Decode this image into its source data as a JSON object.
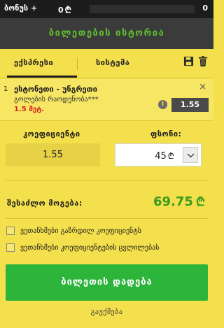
{
  "topbar": {
    "bonus_label": "ბონუს +",
    "bonus_value": "0",
    "currency": "₾",
    "count": "0"
  },
  "header": {
    "title": "ბილეთების ისტორია"
  },
  "tabs": [
    {
      "label": "ექსპრესი",
      "active": true
    },
    {
      "label": "სისტემა",
      "active": false
    }
  ],
  "tab_icons": [
    "save-icon",
    "trash-icon"
  ],
  "selection": {
    "index": "1",
    "match": "ესტონეთი - უნგრეთი",
    "market": "გოლების რაოდენობა***",
    "outcome": "1.5 მეტ.",
    "odds": "1.55",
    "info": "i",
    "close": "×"
  },
  "bet": {
    "coefficient_label": "კოეფიციენტი",
    "stake_label": "ფსონი:",
    "coefficient_value": "1.55",
    "stake_value": "45",
    "currency": "₾"
  },
  "winnings": {
    "label": "შესაძლო მოგება:",
    "value": "69.75",
    "currency": "₾"
  },
  "options": [
    {
      "label": "ვეთანხმები გაზრდილ კოეფიციენტს",
      "checked": false
    },
    {
      "label": "ვეთანხმები კოეფიციენტების ცვლილებას",
      "checked": false
    }
  ],
  "actions": {
    "place_bet": "ბილეთის დადება",
    "cancel": "გაუქმება"
  },
  "colors": {
    "background": "#f4e04d",
    "header": "#3b3b3b",
    "accent_green": "#5fbf2e",
    "button_green": "#2cb43b",
    "win_green": "#3a9b1f",
    "outcome_red": "#d21f1f"
  }
}
